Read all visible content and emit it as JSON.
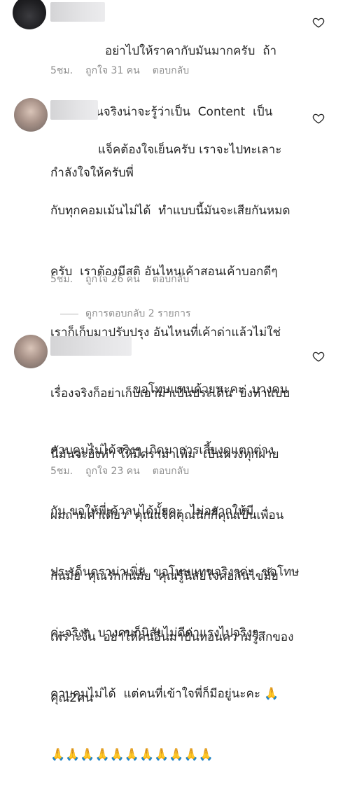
{
  "comments": [
    {
      "lines": [
        "อย่าไปให้ราคากับมันมากครับ  ถ้า",
        "ติดตามกันจริงน่าจะรู้ว่าเป็น  Content  เป็น",
        "กำลังใจให้ครับพี่"
      ],
      "time": "5ชม.",
      "likes": "ถูกใจ 31 คน",
      "reply": "ตอบกลับ"
    },
    {
      "lines": [
        "แจ็คต้องใจเย็นครับ เราจะไปทะเลาะ",
        "กับทุกคอมเม้นไม่ได้  ทำแบบนี้มันจะเสียกันหมด",
        "ครับ  เราต้องมีสติ อันไหนเค้าสอนเค้าบอกดีๆ",
        "เราก็เก็บมาปรับปรุง อันไหนที่เค้าด่าแล้วไม่ใช่",
        "เรื่องจริงก็อย่าเก็บเอามาเป็นประเด็น  ยิ่งทำแบบ",
        "นี้มันจะยิ่งทำ ให้มีดราม่าเพิ่ม  เป็นห่วงทุกฝ่าย",
        "ผมถามคำเดียว  คุณแจ็คคุณนิกกี้คุณเป็นเพื่อน",
        "กันมั้ย  คุณรักกันมั้ย  คุณรู้นิสัยใจคอกันไข่มั้ย",
        "เพราะงั้น  อย่าให้คนอื่นมาบั่นทอนความรู้สึกของ",
        "คุณ2คน"
      ],
      "time": "5ชม.",
      "likes": "ถูกใจ 26 คน",
      "reply": "ตอบกลับ"
    },
    {
      "lines": [
        "ขอโทษแทนด้วยนะคะ  บางคน",
        "ควบคุมไม่ได้จริงๆ เกิดมาการเลี้ยงดูแตกต่าง",
        "กัน ขอให้พี่เค้าลบได้มั้ยคะ  ไม่อยากให้มี",
        "ประเด็นดราม่าเพิ่ม  ขอโทษแทนจริงๆค่ะ  ขอโทษ",
        "ค่ะจริงๆ  บางคนก็นิสัยไม่ดีด่าแรงไปจริงๆ",
        "ควบคุมไม่ได้  แต่คนที่เข้าใจพี่ก็มีอยู่นะคะ 🙏",
        "🙏🙏🙏🙏🙏🙏🙏🙏🙏🙏🙏"
      ],
      "time": "5ชม.",
      "likes": "ถูกใจ 23 คน",
      "reply": "ตอบกลับ"
    }
  ],
  "view_replies": "ดูการตอบกลับ 2 รายการ",
  "colors": {
    "text": "#262626",
    "muted": "#8e8e8e",
    "background": "#ffffff"
  }
}
